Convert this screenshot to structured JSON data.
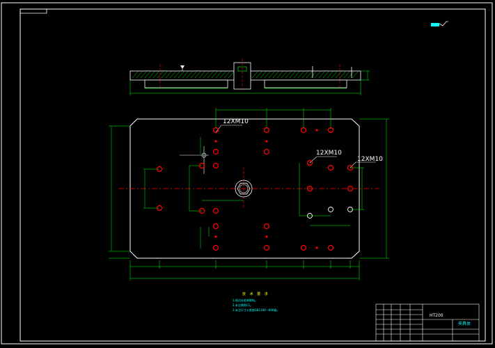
{
  "drawing": {
    "callouts": {
      "top_left_holes": "12XM10",
      "right_holes": "12XM10",
      "far_right_holes": "12XM10"
    },
    "notes": {
      "title": "技 术 要 求",
      "items": [
        "1.锐边去毛刺倒钝。",
        "2.未注倒角C1。",
        "3.未注尺寸公差按GB1184—80K级。"
      ]
    },
    "title_block": {
      "material": "HT200",
      "part_name": "夹具体"
    }
  },
  "colors": {
    "background": "#000000",
    "frame": "#ffffff",
    "outline": "#ffffff",
    "dimension": "#00ff00",
    "centerline": "#ff0000",
    "hole": "#ff0000",
    "hatch": "#00ff00",
    "notes": "#00ffff"
  }
}
